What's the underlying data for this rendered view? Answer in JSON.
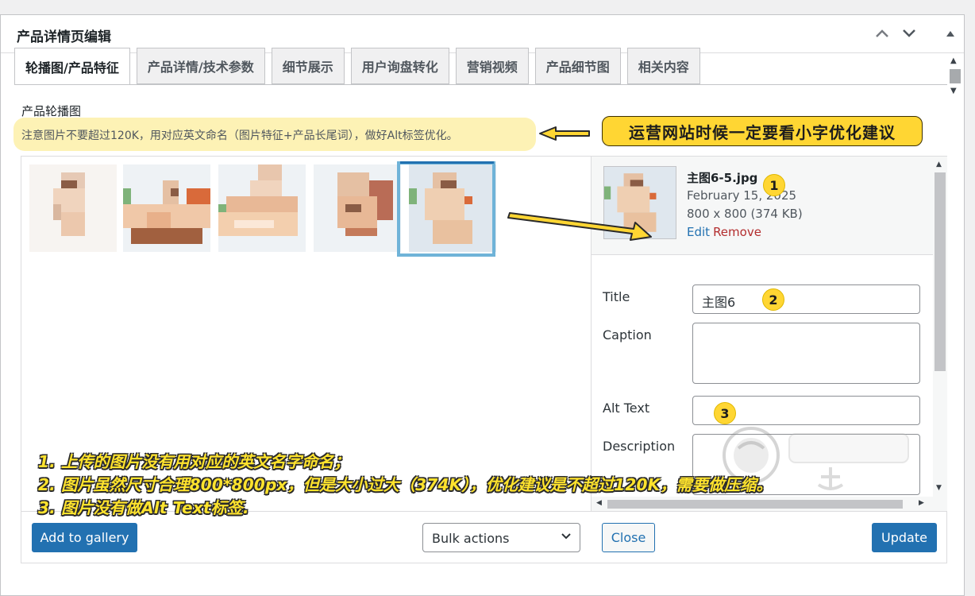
{
  "metabox": {
    "title": "产品详情页编辑"
  },
  "tabs": [
    {
      "label": "轮播图/产品特征",
      "active": true
    },
    {
      "label": "产品详情/技术参数"
    },
    {
      "label": "细节展示"
    },
    {
      "label": "用户询盘转化"
    },
    {
      "label": "营销视频"
    },
    {
      "label": "产品细节图"
    },
    {
      "label": "相关内容"
    }
  ],
  "section": {
    "label": "产品轮播图",
    "notice": "注意图片不要超过120K，用对应英文命名（图片特征+产品长尾词），做好Alt标签优化。"
  },
  "callout": {
    "text": "运营网站时候一定要看小字优化建议"
  },
  "attachment": {
    "filename": "主图6-5.jpg",
    "date": "February 15, 2025",
    "dimensions": "800 x 800 (374 KB)",
    "edit_label": "Edit",
    "remove_label": "Remove"
  },
  "fields": {
    "title_label": "Title",
    "title_value": "主图6",
    "caption_label": "Caption",
    "caption_value": "",
    "alt_label": "Alt Text",
    "alt_value": "",
    "description_label": "Description",
    "description_value": ""
  },
  "toolbar": {
    "add_gallery": "Add to gallery",
    "bulk_actions": "Bulk actions",
    "close": "Close",
    "update": "Update"
  },
  "badges": [
    "1",
    "2",
    "3"
  ],
  "annotations": [
    "1. 上传的图片没有用对应的英文名字命名；",
    "2. 图片虽然尺寸合理800*800px，但是大小过大（374K），优化建议是不超过120K，需要做压缩。",
    "3. 图片没有做Alt Text标签."
  ],
  "colors": {
    "accent": "#2271b1",
    "notice_bg": "#fdf2b5",
    "callout_bg": "#ffd633",
    "remove": "#b32d2e"
  }
}
